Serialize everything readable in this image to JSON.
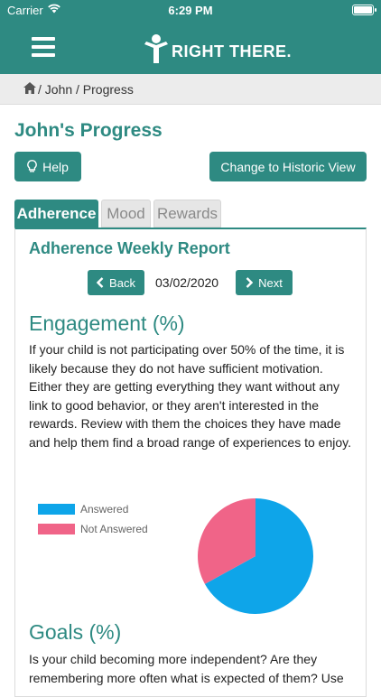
{
  "status_bar": {
    "carrier": "Carrier",
    "time": "6:29 PM"
  },
  "header": {
    "logo_text": "RIGHT THERE."
  },
  "breadcrumb": {
    "path": "/ John / Progress"
  },
  "page": {
    "title": "John's Progress"
  },
  "buttons": {
    "help": "Help",
    "historic_view": "Change to Historic View"
  },
  "tabs": [
    {
      "label": "Adherence",
      "active": true
    },
    {
      "label": "Mood",
      "active": false
    },
    {
      "label": "Rewards",
      "active": false
    }
  ],
  "report": {
    "title": "Adherence Weekly Report",
    "back_label": "Back",
    "next_label": "Next",
    "date": "03/02/2020"
  },
  "engagement": {
    "heading": "Engagement (%)",
    "body": "If your child is not participating over 50% of the time, it is likely because they do not have sufficient motivation. Either they are getting everything they want without any link to good behavior, or they aren't interested in the rewards. Review with them the choices they have made and help them find a broad range of experiences to enjoy."
  },
  "chart_data": {
    "type": "pie",
    "title": "",
    "legend_position": "left",
    "slices": [
      {
        "label": "Answered",
        "value": 67,
        "color": "#0ea5e9"
      },
      {
        "label": "Not Answered",
        "value": 33,
        "color": "#f06488"
      }
    ]
  },
  "goals": {
    "heading": "Goals (%)",
    "body": "Is your child becoming more independent? Are they remembering more often what is expected of them? Use"
  },
  "colors": {
    "brand": "#2e8a82",
    "answered": "#0ea5e9",
    "not_answered": "#f06488"
  }
}
